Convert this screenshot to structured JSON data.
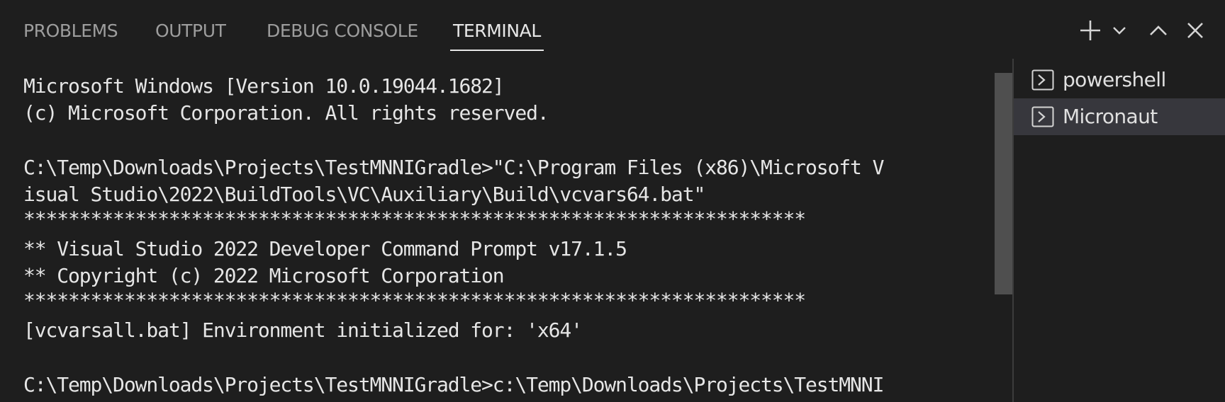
{
  "tabs": {
    "problems": "PROBLEMS",
    "output": "OUTPUT",
    "debug_console": "DEBUG CONSOLE",
    "terminal": "TERMINAL",
    "active": "terminal"
  },
  "actions": {
    "new_terminal": "plus-icon",
    "launch_profile": "chevron-down-icon",
    "maximize_panel": "chevron-up-icon",
    "close_panel": "close-icon"
  },
  "terminal": {
    "lines": [
      "Microsoft Windows [Version 10.0.19044.1682]",
      "(c) Microsoft Corporation. All rights reserved.",
      "",
      "C:\\Temp\\Downloads\\Projects\\TestMNNIGradle>\"C:\\Program Files (x86)\\Microsoft V",
      "isual Studio\\2022\\BuildTools\\VC\\Auxiliary\\Build\\vcvars64.bat\"",
      "**********************************************************************",
      "** Visual Studio 2022 Developer Command Prompt v17.1.5",
      "** Copyright (c) 2022 Microsoft Corporation",
      "**********************************************************************",
      "[vcvarsall.bat] Environment initialized for: 'x64'",
      "",
      "C:\\Temp\\Downloads\\Projects\\TestMNNIGradle>c:\\Temp\\Downloads\\Projects\\TestMNNI"
    ]
  },
  "shells": [
    {
      "label": "powershell",
      "icon": "terminal-icon",
      "selected": false
    },
    {
      "label": "Micronaut",
      "icon": "terminal-icon",
      "selected": true
    }
  ],
  "colors": {
    "background": "#1e1e1e",
    "selected_item": "#37373d",
    "scrollbar": "#4f4f4f",
    "text": "#e6e6e6"
  }
}
